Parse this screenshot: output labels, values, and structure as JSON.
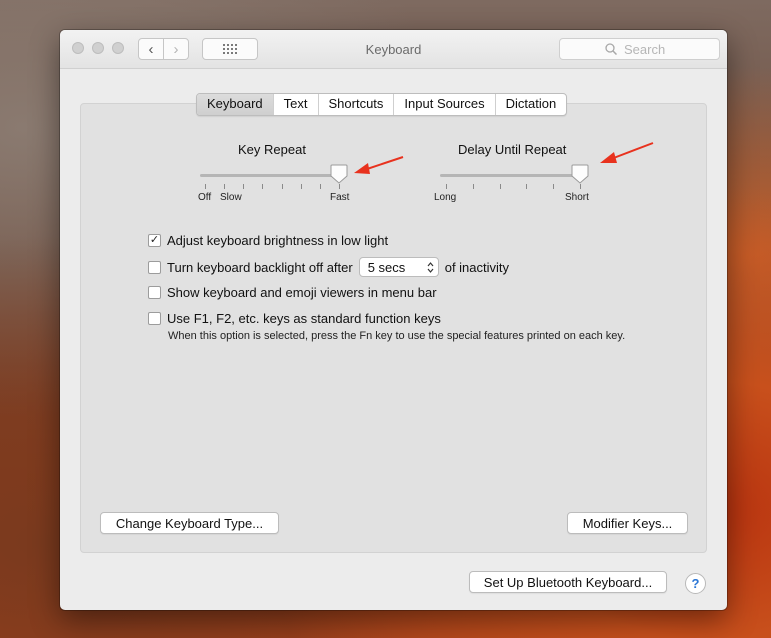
{
  "window": {
    "title": "Keyboard"
  },
  "search": {
    "placeholder": "Search"
  },
  "tabs": [
    {
      "label": "Keyboard",
      "selected": true
    },
    {
      "label": "Text",
      "selected": false
    },
    {
      "label": "Shortcuts",
      "selected": false
    },
    {
      "label": "Input Sources",
      "selected": false
    },
    {
      "label": "Dictation",
      "selected": false
    }
  ],
  "key_repeat": {
    "title": "Key Repeat",
    "labels": {
      "off": "Off",
      "slow": "Slow",
      "fast": "Fast"
    },
    "ticks": 8,
    "value_fraction": 1.0
  },
  "delay_until_repeat": {
    "title": "Delay Until Repeat",
    "labels": {
      "long": "Long",
      "short": "Short"
    },
    "ticks": 6,
    "value_fraction": 1.0
  },
  "options": {
    "brightness": {
      "label": "Adjust keyboard brightness in low light",
      "checked": true
    },
    "backlight": {
      "label_before": "Turn keyboard backlight off after",
      "value": "5 secs",
      "label_after": "of inactivity",
      "checked": false
    },
    "viewers": {
      "label": "Show keyboard and emoji viewers in menu bar",
      "checked": false
    },
    "fn_keys": {
      "label": "Use F1, F2, etc. keys as standard function keys",
      "checked": false,
      "hint": "When this option is selected, press the Fn key to use the special features printed on each key."
    }
  },
  "buttons": {
    "change_type": "Change Keyboard Type...",
    "modifier_keys": "Modifier Keys...",
    "bluetooth": "Set Up Bluetooth Keyboard...",
    "help": "?"
  },
  "colors": {
    "annotation_arrow": "#e8321e",
    "accent": "#2a76d6"
  }
}
